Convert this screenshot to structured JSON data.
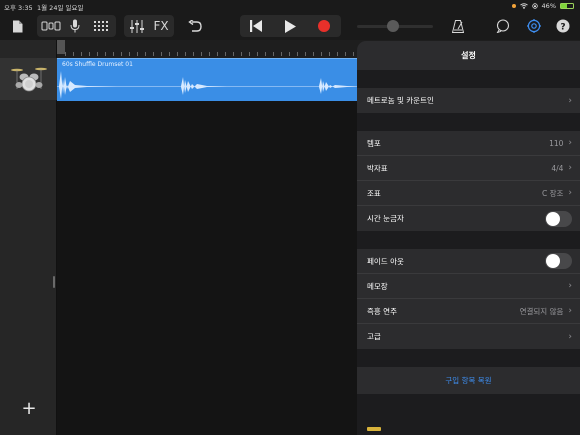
{
  "status_bar": {
    "time": "오후 3:35",
    "date": "1월 24일 일요일",
    "battery": "46%"
  },
  "toolbar": {
    "fx_label": "FX",
    "icons": [
      "document-icon",
      "tracks-view-icon",
      "microphone-icon",
      "grid-icon",
      "mixer-icon",
      "fx",
      "undo-icon",
      "rewind-icon",
      "play-icon",
      "record-icon",
      "volume-slider",
      "metronome-icon",
      "loop-icon",
      "settings-icon",
      "help-icon"
    ],
    "colors": {
      "record": "#e8302a",
      "accent": "#3e8ef0"
    }
  },
  "track": {
    "region_name": "60s Shuffle Drumset 01",
    "region_color": "#3a8ee6",
    "instrument_icon": "drum-kit-icon"
  },
  "settings": {
    "title": "설정",
    "group1": [
      {
        "label": "메트로놈 및 카운트인",
        "value": "",
        "type": "chevron"
      }
    ],
    "group2": [
      {
        "label": "템포",
        "value": "110",
        "type": "chevron"
      },
      {
        "label": "박자표",
        "value": "4/4",
        "type": "chevron"
      },
      {
        "label": "조표",
        "value": "C 장조",
        "type": "chevron"
      },
      {
        "label": "시간 눈금자",
        "value": "",
        "type": "toggle",
        "on": false
      }
    ],
    "group3": [
      {
        "label": "페이드 아웃",
        "value": "",
        "type": "toggle",
        "on": false
      },
      {
        "label": "메모장",
        "value": "",
        "type": "chevron"
      },
      {
        "label": "즉흥 연주",
        "value": "연결되지 않음",
        "type": "chevron"
      },
      {
        "label": "고급",
        "value": "",
        "type": "chevron"
      }
    ],
    "restore_purchases": "구입 항목 복원"
  }
}
